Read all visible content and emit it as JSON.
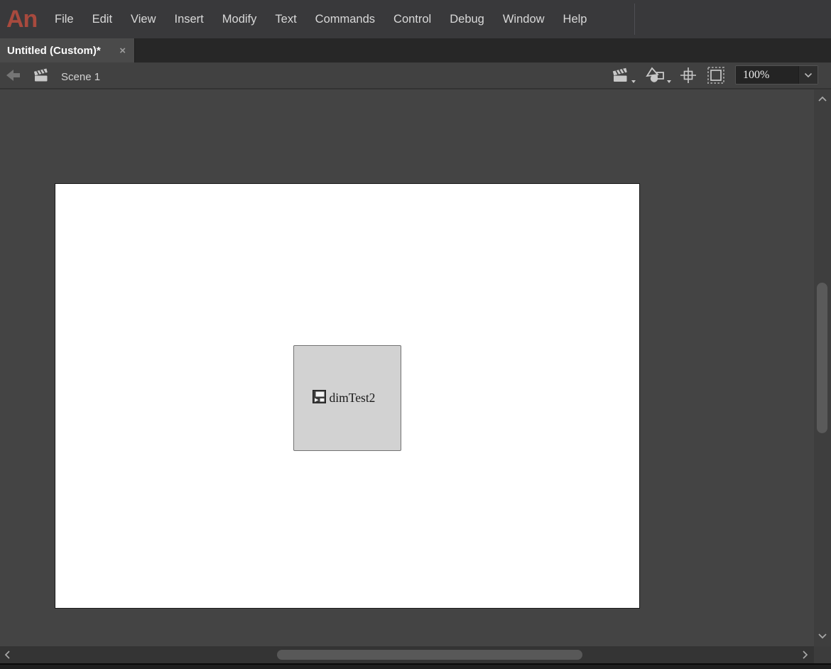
{
  "app": {
    "logo": "An"
  },
  "menu_bar": {
    "items": [
      "File",
      "Edit",
      "View",
      "Insert",
      "Modify",
      "Text",
      "Commands",
      "Control",
      "Debug",
      "Window",
      "Help"
    ]
  },
  "tabs": {
    "active": {
      "title": "Untitled (Custom)*",
      "close": "×"
    }
  },
  "edit_bar": {
    "scene_label": "Scene 1",
    "zoom": {
      "value": "100%"
    }
  },
  "stage": {
    "component": {
      "label": "dimTest2"
    }
  },
  "icons": {
    "logo": "animate-logo",
    "back": "back-arrow-icon",
    "scene": "clapperboard-icon",
    "edit_scene": "edit-scene-icon",
    "edit_symbols": "edit-symbols-icon",
    "center_frame": "center-frame-icon",
    "clip_content": "clip-content-icon",
    "zoom_chevron": "chevron-down-icon",
    "component": "video-component-icon"
  },
  "colors": {
    "menu_bar_bg": "#39393b",
    "logo_red": "#a84a3e",
    "tab_bar_bg": "#272727",
    "active_tab_bg": "#4a4a4a",
    "edit_bar_bg": "#414141",
    "pasteboard": "#444444",
    "stage_bg": "#ffffff",
    "component_fill": "#d2d2d2",
    "component_border": "#737373",
    "scrollbar_thumb": "#5a5a5a",
    "icon_gray": "#c8c8c8"
  }
}
